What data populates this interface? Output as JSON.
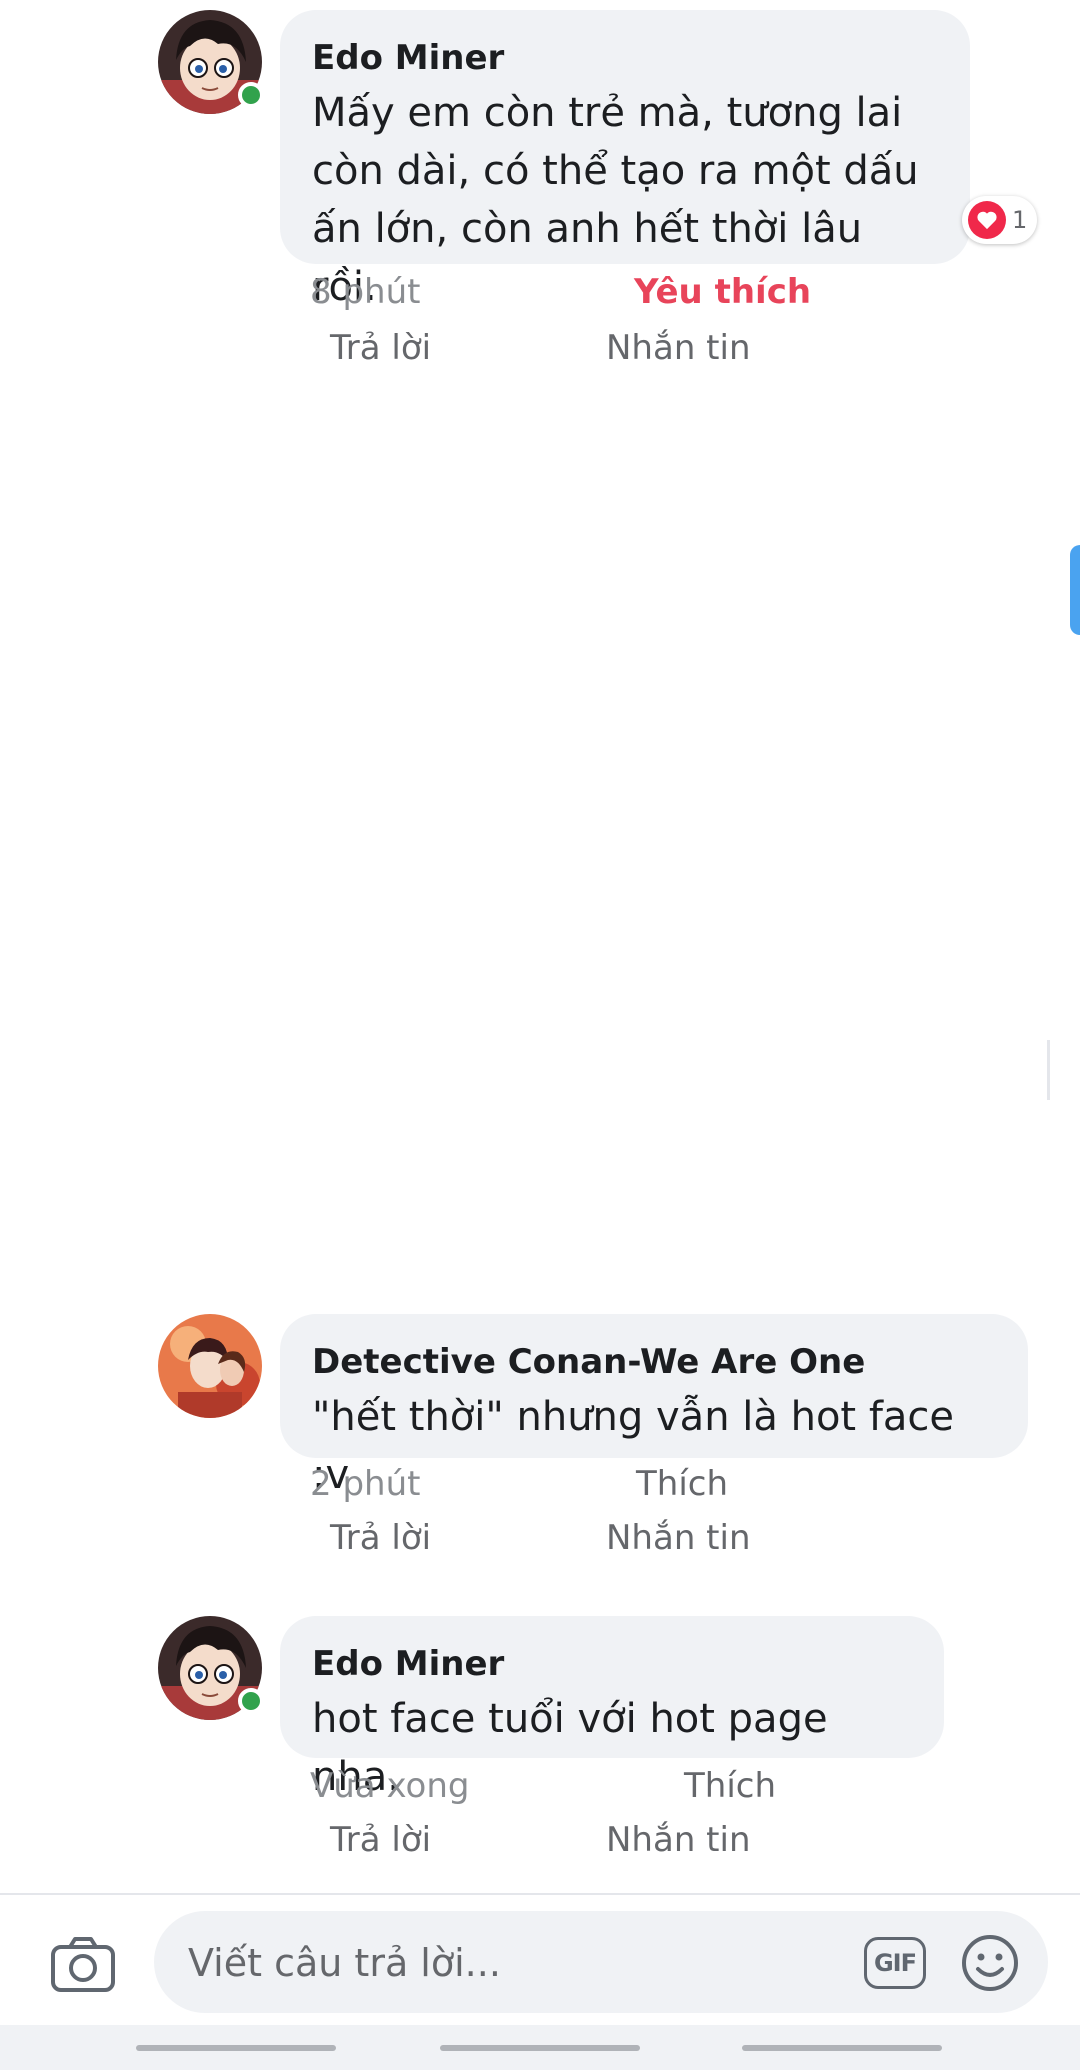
{
  "comments": [
    {
      "author": "Edo Miner",
      "text_lines": [
        "Mấy em còn trẻ mà, tương lai",
        "còn dài, có thể tạo ra một dấu",
        "ấn lớn, còn anh hết thời lâu rồi."
      ],
      "time": "8 phút",
      "like_label": "Yêu thích",
      "liked": true,
      "reply_label": "Trả lời",
      "message_label": "Nhắn tin",
      "reaction": {
        "icon": "heart-icon",
        "count": "1"
      },
      "online": true
    },
    {
      "author": "Detective Conan-We Are One",
      "text_lines": [
        "\"hết thời\" nhưng vẫn là hot face :v"
      ],
      "time": "2 phút",
      "like_label": "Thích",
      "liked": false,
      "reply_label": "Trả lời",
      "message_label": "Nhắn tin",
      "online": false
    },
    {
      "author": "Edo Miner",
      "text_lines": [
        "hot face tuổi với hot page nha."
      ],
      "time": "Vừa xong",
      "like_label": "Thích",
      "liked": false,
      "reply_label": "Trả lời",
      "message_label": "Nhắn tin",
      "online": true
    }
  ],
  "composer": {
    "placeholder": "Viết câu trả lời...",
    "gif_label": "GIF",
    "camera_icon": "camera-icon",
    "emoji_icon": "smiley-icon"
  },
  "colors": {
    "bubble": "#f0f2f5",
    "liked": "#e8445a",
    "meta": "#8a8d91",
    "online": "#31a24c",
    "heart": "#f0284a"
  }
}
